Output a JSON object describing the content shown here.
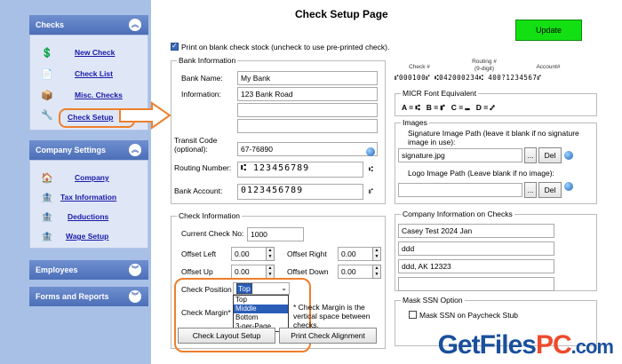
{
  "sidebar": {
    "checks": {
      "title": "Checks",
      "items": [
        {
          "label": "New Check",
          "icon": "dollar-icon"
        },
        {
          "label": "Check List",
          "icon": "list-icon"
        },
        {
          "label": "Misc. Checks",
          "icon": "misc-icon"
        },
        {
          "label": "Check Setup",
          "icon": "wrench-icon",
          "selected": true
        }
      ]
    },
    "company": {
      "title": "Company Settings",
      "items": [
        {
          "label": "Company",
          "icon": "home-icon"
        },
        {
          "label": "Tax Information",
          "icon": "tax-icon"
        },
        {
          "label": "Deductions",
          "icon": "deductions-icon"
        },
        {
          "label": "Wage Setup",
          "icon": "wage-icon"
        }
      ]
    },
    "employees": {
      "title": "Employees"
    },
    "forms": {
      "title": "Forms and Reports"
    }
  },
  "header": {
    "title": "Check Setup Page",
    "update_label": "Update"
  },
  "blank_stock_label": "Print on blank check stock (uncheck to use pre-printed check).",
  "bank": {
    "title": "Bank Information",
    "name_label": "Bank Name:",
    "name_value": "My Bank",
    "info_label": "Information:",
    "info_value": "123 Bank Road",
    "transit_label": "Transit Code",
    "transit_label2": "(optional):",
    "transit_value": "67-76890",
    "routing_label": "Routing Number:",
    "routing_value": "⑆ 123456789",
    "account_label": "Bank Account:",
    "account_value": "0123456789"
  },
  "micr": {
    "check_label": "Check #",
    "routing_label": "Routing #",
    "routing_sub": "(9-digit)",
    "account_label": "Account#",
    "line": "⑈000100⑈ ⑆042000234⑆ 400?1234567⑈",
    "font_title": "MICR Font Equivalent",
    "equivalents": "A = ⑆   B = ⑈   C = ⑉   D = ⑇"
  },
  "images": {
    "title": "Images",
    "sig_label": "Signature Image Path (leave it blank if no signature image in use):",
    "sig_value": "signature.jpg",
    "browse": "...",
    "del": "Del",
    "logo_label": "Logo Image Path (Leave blank if no image):",
    "logo_value": ""
  },
  "check_info": {
    "title": "Check Information",
    "current_label": "Current Check No:",
    "current_value": "1000",
    "offset_left_label": "Offset Left",
    "offset_left_value": "0.00",
    "offset_right_label": "Offset Right",
    "offset_right_value": "0.00",
    "offset_up_label": "Offset Up",
    "offset_up_value": "0.00",
    "offset_down_label": "Offset Down",
    "offset_down_value": "0.00",
    "position_label": "Check Position",
    "position_value": "Top",
    "position_options": [
      "Top",
      "Middle",
      "Bottom",
      "3-per-Page"
    ],
    "margin_label": "Check Margin*",
    "margin_note": "* Check Margin is the vertical space between checks.",
    "layout_btn": "Check Layout Setup",
    "print_btn": "Print Check Alignment"
  },
  "company_info": {
    "title": "Company Information on Checks",
    "line1": "Casey Test 2024 Jan",
    "line2": "ddd",
    "line3": "ddd, AK 12323",
    "line4": ""
  },
  "mask_ssn": {
    "title": "Mask SSN Option",
    "label": "Mask SSN on Paycheck Stub"
  },
  "watermark": {
    "a": "GetFiles",
    "b": "PC",
    "c": ".com"
  },
  "colors": {
    "accent": "#ee7f2c",
    "update": "#13e013",
    "sidebar": "#a9c0e6",
    "link": "#1a1aa8"
  }
}
